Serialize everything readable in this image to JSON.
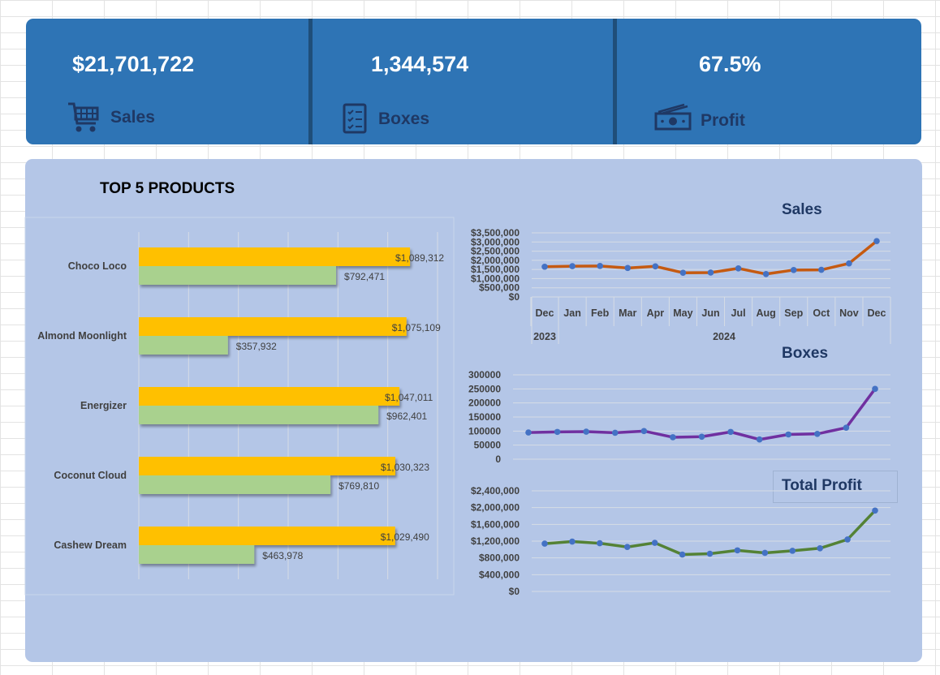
{
  "kpis": [
    {
      "value": "$21,701,722",
      "label": "Sales",
      "icon": "shopping-cart-icon"
    },
    {
      "value": "1,344,574",
      "label": "Boxes",
      "icon": "checklist-icon"
    },
    {
      "value": "67.5%",
      "label": "Profit",
      "icon": "cash-icon"
    }
  ],
  "top_products": {
    "title": "TOP 5 PRODUCTS"
  },
  "charts": {
    "sales_title": "Sales",
    "boxes_title": "Boxes",
    "profit_title": "Total Profit"
  },
  "colors": {
    "header_bg": "#2e74b5",
    "panel_bg": "#b4c6e7",
    "bar_primary": "#ffc000",
    "bar_secondary": "#a9d18e",
    "sales_line": "#c55a11",
    "boxes_line": "#7030a0",
    "profit_line": "#548235",
    "marker": "#4472c4"
  },
  "chart_data": [
    {
      "type": "bar",
      "orientation": "horizontal",
      "categories": [
        "Choco Loco",
        "Almond Moonlight",
        "Energizer",
        "Coconut Cloud",
        "Cashew Dream"
      ],
      "series": [
        {
          "values": [
            1089312,
            1075109,
            1047011,
            1030323,
            1029490
          ],
          "labels": [
            "$1,089,312",
            "$1,075,109",
            "$1,047,011",
            "$1,030,323",
            "$1,029,490"
          ]
        },
        {
          "values": [
            792471,
            357932,
            962401,
            769810,
            463978
          ],
          "labels": [
            "$792,471",
            "$357,932",
            "$962,401",
            "$769,810",
            "$463,978"
          ]
        }
      ],
      "xlim": [
        0,
        1200000
      ],
      "grid": true
    },
    {
      "type": "line",
      "title": "Sales",
      "x": [
        "Dec",
        "Jan",
        "Feb",
        "Mar",
        "Apr",
        "May",
        "Jun",
        "Jul",
        "Aug",
        "Sep",
        "Oct",
        "Nov",
        "Dec"
      ],
      "x_groups": [
        {
          "label": "2023",
          "count": 1
        },
        {
          "label": "2024",
          "count": 12
        }
      ],
      "values": [
        1650000,
        1680000,
        1690000,
        1580000,
        1670000,
        1320000,
        1330000,
        1560000,
        1250000,
        1470000,
        1480000,
        1830000,
        3050000
      ],
      "ylim": [
        0,
        3500000
      ],
      "yticks": [
        "$0",
        "$500,000",
        "$1,000,000",
        "$1,500,000",
        "$2,000,000",
        "$2,500,000",
        "$3,000,000",
        "$3,500,000"
      ],
      "grid": true
    },
    {
      "type": "line",
      "title": "Boxes",
      "x": [
        "Dec",
        "Jan",
        "Feb",
        "Mar",
        "Apr",
        "May",
        "Jun",
        "Jul",
        "Aug",
        "Sep",
        "Oct",
        "Nov",
        "Dec"
      ],
      "values": [
        95000,
        97000,
        98000,
        94000,
        100000,
        78000,
        80000,
        97000,
        70000,
        88000,
        90000,
        112000,
        250000
      ],
      "ylim": [
        0,
        300000
      ],
      "yticks": [
        "0",
        "50000",
        "100000",
        "150000",
        "200000",
        "250000",
        "300000"
      ],
      "grid": true
    },
    {
      "type": "line",
      "title": "Total Profit",
      "x": [
        "Dec",
        "Jan",
        "Feb",
        "Mar",
        "Apr",
        "May",
        "Jun",
        "Jul",
        "Aug",
        "Sep",
        "Oct",
        "Nov",
        "Dec"
      ],
      "values": [
        1140000,
        1190000,
        1150000,
        1060000,
        1160000,
        880000,
        900000,
        980000,
        920000,
        970000,
        1030000,
        1240000,
        1930000
      ],
      "ylim": [
        0,
        2400000
      ],
      "yticks": [
        "$0",
        "$400,000",
        "$800,000",
        "$1,200,000",
        "$1,600,000",
        "$2,000,000",
        "$2,400,000"
      ],
      "grid": true
    }
  ]
}
